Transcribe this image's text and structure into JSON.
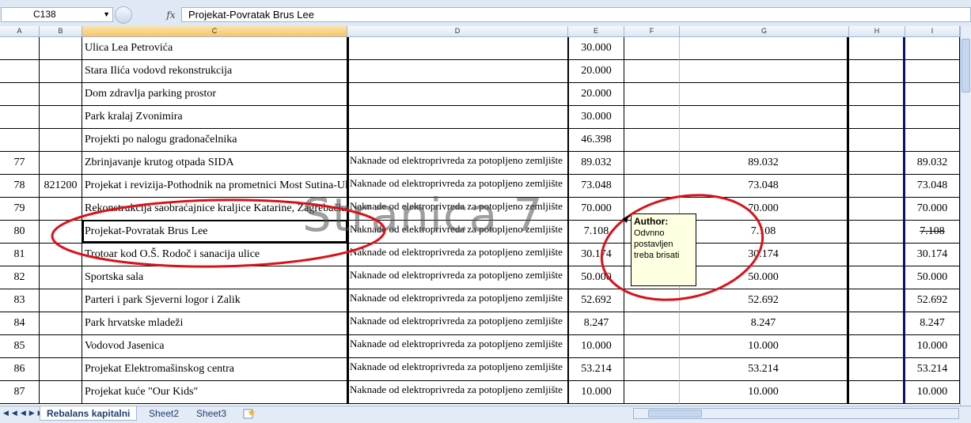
{
  "formula_bar": {
    "name_box": "C138",
    "fx_label": "fx",
    "content": "Projekat-Povratak Brus Lee"
  },
  "columns": [
    "A",
    "B",
    "C",
    "D",
    "E",
    "F",
    "G",
    "H",
    "I"
  ],
  "rows": [
    {
      "a": "",
      "b": "",
      "c": "Ulica Lea Petrovića",
      "d": "",
      "e": "30.000",
      "g": "",
      "i": ""
    },
    {
      "a": "",
      "b": "",
      "c": "Stara Ilića vodovd rekonstrukcija",
      "d": "",
      "e": "20.000",
      "g": "",
      "i": ""
    },
    {
      "a": "",
      "b": "",
      "c": "Dom zdravlja parking prostor",
      "d": "",
      "e": "20.000",
      "g": "",
      "i": ""
    },
    {
      "a": "",
      "b": "",
      "c": "Park  kralaj Zvonimira",
      "d": "",
      "e": "30.000",
      "g": "",
      "i": ""
    },
    {
      "a": "",
      "b": "",
      "c": "Projekti po nalogu gradonačelnika",
      "d": "",
      "e": "46.398",
      "g": "",
      "i": ""
    },
    {
      "a": "77",
      "b": "",
      "c": "Zbrinjavanje krutog otpada SIDA",
      "d": "Naknade od elektroprivreda za potopljeno zemljište",
      "e": "89.032",
      "g": "89.032",
      "i": "89.032"
    },
    {
      "a": "78",
      "b": "821200",
      "c": "Projekat i revizija-Pothodnik na prometnici Most Sutina-Ul. M.Tita",
      "d": "Naknade od elektroprivreda za potopljeno zemljište",
      "e": "73.048",
      "g": "73.048",
      "i": "73.048"
    },
    {
      "a": "79",
      "b": "",
      "c": "Rekonstrukcija saobraćajnice kraljice Katarine, Zagrebačka i ulice Tamburaška",
      "d": "Naknade od elektroprivreda za potopljeno zemljište",
      "e": "70.000",
      "g": "70.000",
      "i": "70.000"
    },
    {
      "a": "80",
      "b": "",
      "c": "Projekat-Povratak Brus Lee",
      "d": "Naknade od elektroprivreda za potopljeno zemljište",
      "e": "7.108",
      "g": "7.108",
      "i": "7.108"
    },
    {
      "a": "81",
      "b": "",
      "c": "Trotoar kod O.Š. Rodoč i sanacija ulice",
      "d": "Naknade od elektroprivreda za potopljeno zemljište",
      "e": "30.174",
      "g": "30.174",
      "i": "30.174"
    },
    {
      "a": "82",
      "b": "",
      "c": "Sportska sala",
      "d": "Naknade od elektroprivreda za potopljeno zemljište",
      "e": "50.000",
      "g": "50.000",
      "i": "50.000"
    },
    {
      "a": "83",
      "b": "",
      "c": "Parteri i park Sjeverni logor i Zalik",
      "d": "Naknade od elektroprivreda za potopljeno zemljište",
      "e": "52.692",
      "g": "52.692",
      "i": "52.692"
    },
    {
      "a": "84",
      "b": "",
      "c": "Park hrvatske mladeži",
      "d": "Naknade od elektroprivreda za potopljeno zemljište",
      "e": "8.247",
      "g": "8.247",
      "i": "8.247"
    },
    {
      "a": "85",
      "b": "",
      "c": "Vodovod Jasenica",
      "d": "Naknade od elektroprivreda za potopljeno zemljište",
      "e": "10.000",
      "g": "10.000",
      "i": "10.000"
    },
    {
      "a": "86",
      "b": "",
      "c": "Projekat Elektromašinskog centra",
      "d": "Naknade od elektroprivreda za potopljeno zemljište",
      "e": "53.214",
      "g": "53.214",
      "i": "53.214"
    },
    {
      "a": "87",
      "b": "",
      "c": "Projekat kuće \"Our Kids\"",
      "d": "Naknade od elektroprivreda za potopljeno zemljište",
      "e": "10.000",
      "g": "10.000",
      "i": "10.000"
    }
  ],
  "comment": {
    "author": "Author:",
    "text_1": "Odvnno",
    "text_2": "postavljen",
    "text_3": "treba brisati"
  },
  "watermark": "Stranica 7",
  "sheet_tabs": [
    {
      "label": "Rebalans kapitalni",
      "active": true
    },
    {
      "label": "Sheet2",
      "active": false
    },
    {
      "label": "Sheet3",
      "active": false
    }
  ],
  "colors": {
    "ellipse": "#d9121a",
    "ui_blue": "#dfe8f5"
  }
}
